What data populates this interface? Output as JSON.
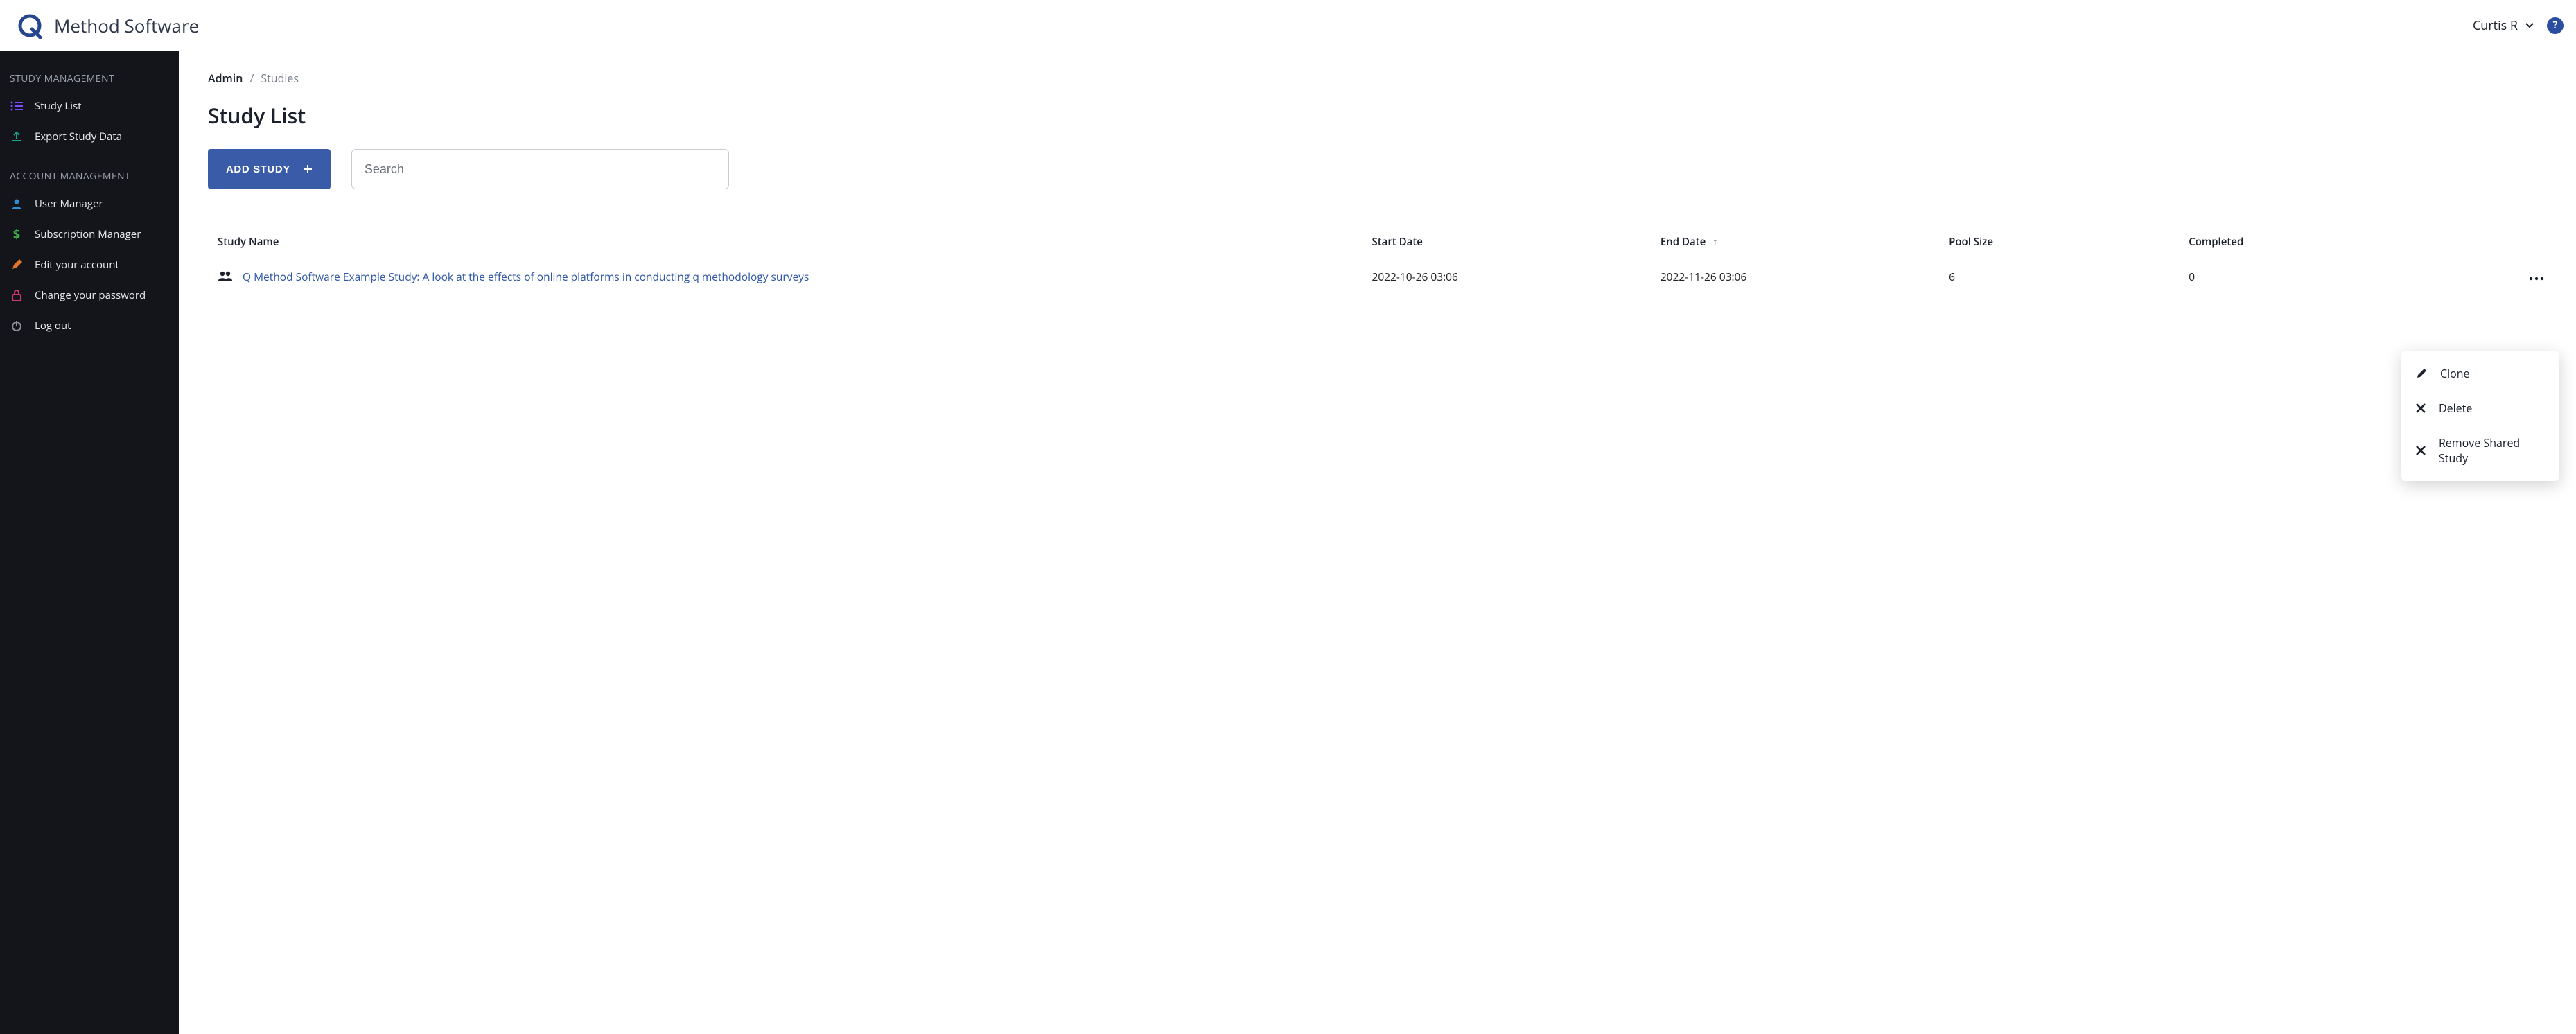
{
  "brand": {
    "name": "Method Software"
  },
  "header": {
    "user_name": "Curtis R"
  },
  "sidebar": {
    "section_study": "STUDY MANAGEMENT",
    "section_account": "ACCOUNT MANAGEMENT",
    "study_items": [
      {
        "label": "Study List"
      },
      {
        "label": "Export Study Data"
      }
    ],
    "account_items": [
      {
        "label": "User Manager"
      },
      {
        "label": "Subscription Manager"
      },
      {
        "label": "Edit your account"
      },
      {
        "label": "Change your password"
      },
      {
        "label": "Log out"
      }
    ]
  },
  "breadcrumb": {
    "root": "Admin",
    "sep": "/",
    "current": "Studies"
  },
  "page": {
    "title": "Study List"
  },
  "controls": {
    "add_study_label": "ADD STUDY",
    "search_placeholder": "Search"
  },
  "table": {
    "headers": {
      "name": "Study Name",
      "start": "Start Date",
      "end": "End Date",
      "pool": "Pool Size",
      "completed": "Completed"
    },
    "sorted_column": "end",
    "sort_direction": "asc",
    "rows": [
      {
        "name": "Q Method Software Example Study: A look at the effects of online platforms in conducting q methodology surveys",
        "start": "2022-10-26 03:06",
        "end": "2022-11-26 03:06",
        "pool": "6",
        "completed": "0"
      }
    ]
  },
  "row_menu": {
    "clone": "Clone",
    "delete": "Delete",
    "remove_shared": "Remove Shared Study"
  }
}
